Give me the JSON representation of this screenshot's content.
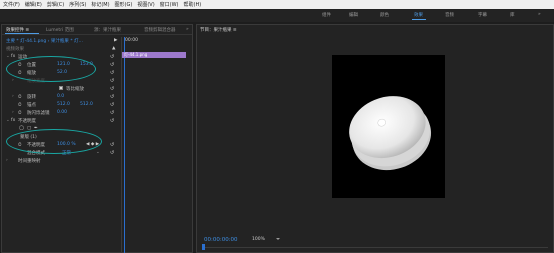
{
  "menu": [
    "文件(F)",
    "编辑(E)",
    "剪辑(C)",
    "序列(S)",
    "标记(M)",
    "图形(G)",
    "视图(V)",
    "窗口(W)",
    "帮助(H)"
  ],
  "workspaces": [
    "组件",
    "编辑",
    "颜色",
    "效果",
    "音频",
    "字幕",
    "库"
  ],
  "active_workspace": "效果",
  "effect_controls": {
    "tabs": [
      "效果控件 ≡",
      "Lumetri 范围",
      "源：果汁瓶果",
      "音频剪辑混合器"
    ],
    "more": "»",
    "source_line": "主要 * 灯-44.1.png  ›  果汁瓶果 * 灯…",
    "section": "视频效果",
    "clip_label": "灯-44.1.png",
    "motion": "运动",
    "position_label": "位置",
    "position_x": "121.0",
    "position_y": "153.0",
    "scale_label": "缩放",
    "scale_value": "52.0",
    "scale_width_label": "缩放宽度",
    "uniform_scale_label": "等比缩放",
    "rotation_label": "旋转",
    "rotation_value": "0.0",
    "anchor_label": "锚点",
    "anchor_x": "512.0",
    "anchor_y": "512.0",
    "antiflicker_label": "防闪烁滤镜",
    "antiflicker_value": "0.00",
    "opacity_group": "不透明度",
    "mask_label": "蒙版 (1)",
    "opacity_label": "不透明度",
    "opacity_value": "100.0 %",
    "blend_label": "混合模式",
    "blend_value": "正常",
    "time_remap": "时间重映射",
    "timeline_time": "00:00",
    "timeline_clip": "灯-44.1.png"
  },
  "program_monitor": {
    "title": "节目：果汁瓶果  ≡",
    "timecode": "00:00:00:00",
    "zoom": "100%"
  },
  "colors": {
    "accent": "#4f9de6",
    "annotation": "#19a6a2",
    "clip": "#9d79cc"
  }
}
